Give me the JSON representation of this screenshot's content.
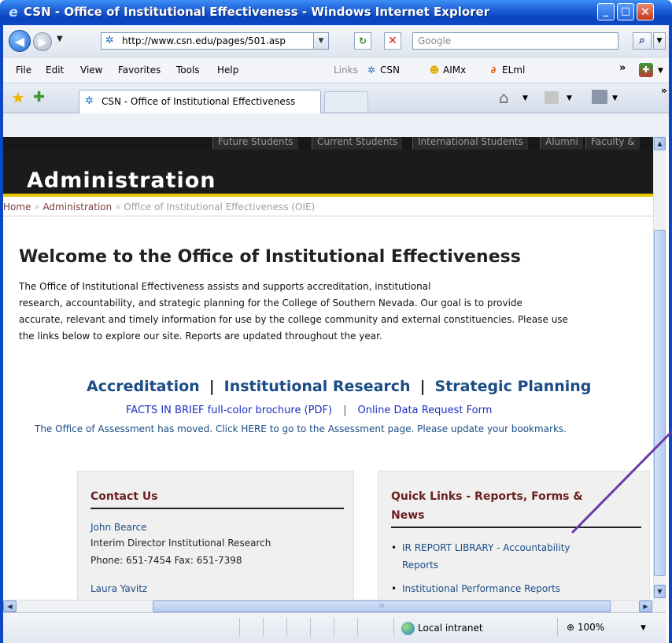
{
  "window": {
    "title": "CSN - Office of Institutional Effectiveness - Windows Internet Explorer",
    "minimize": "_",
    "maximize": "□",
    "close": "✕"
  },
  "navbar": {
    "back_glyph": "◀",
    "forward_glyph": "▶",
    "dropdown_glyph": "▼",
    "address": "http://www.csn.edu/pages/501.asp",
    "refresh_glyph": "↻",
    "stop_glyph": "✕",
    "search_placeholder": "Google",
    "search_glyph": "⌕"
  },
  "menu": {
    "file": "File",
    "edit": "Edit",
    "view": "View",
    "favorites": "Favorites",
    "tools": "Tools",
    "help": "Help",
    "links_label": "Links",
    "links": [
      "CSN",
      "AIMx",
      "ELml"
    ],
    "chevron": "»"
  },
  "tabs": {
    "active_label": "CSN - Office of Institutional Effectiveness",
    "chevron": "»"
  },
  "site": {
    "top_nav": [
      "Future Students",
      "Current Students",
      "International Students",
      "Alumni",
      "Faculty &"
    ],
    "banner_title": "Administration",
    "breadcrumb": {
      "home": "Home",
      "sep": "»",
      "admin": "Administration",
      "current": "Office of Institutional Effectiveness (OIE)"
    },
    "heading": "Welcome to the Office of Institutional Effectiveness",
    "intro_lines": [
      "The Office of Institutional Effectiveness assists and supports accreditation, institutional",
      "research, accountability, and strategic planning for the College of Southern Nevada.  Our goal is to provide",
      "accurate, relevant and timely information for use by the college community and external constituencies. Please use",
      "the links below to explore our site. Reports are updated throughout the year."
    ],
    "main_links": [
      "Accreditation",
      "Institutional Research",
      "Strategic Planning"
    ],
    "pipe": "|",
    "facts_link": "FACTS IN BRIEF  full-color brochure (PDF)",
    "data_request_link": "Online Data Request Form",
    "assessment_notice": "The Office of Assessment has moved. Click HERE to go to the Assessment page. Please update your bookmarks.",
    "contact": {
      "heading": "Contact Us",
      "person1_name": "John Bearce",
      "person1_title": "Interim Director Institutional Research",
      "person1_phone": "Phone: 651-7454 Fax: 651-7398",
      "person2_name": "Laura Yavitz"
    },
    "quicklinks": {
      "heading_line1": "Quick Links - Reports, Forms &",
      "heading_line2": "News",
      "bullet": "•",
      "item1_line1": "IR REPORT LIBRARY - Accountability",
      "item1_line2": "Reports",
      "item2": "Institutional Performance Reports"
    }
  },
  "statusbar": {
    "zone": "Local intranet",
    "zoom": "100%",
    "zoom_drop": "▼"
  },
  "scroll": {
    "up": "▲",
    "down": "▼",
    "left": "◀",
    "right": "▶",
    "grip": "III"
  },
  "colors": {
    "titlebar": "#1d5fd6",
    "banner": "#1b1b1b",
    "banner_accent": "#e8c800",
    "link_blue": "#1b4c86",
    "box_heading": "#6b1f1f",
    "annotation": "#6a3aa8"
  }
}
